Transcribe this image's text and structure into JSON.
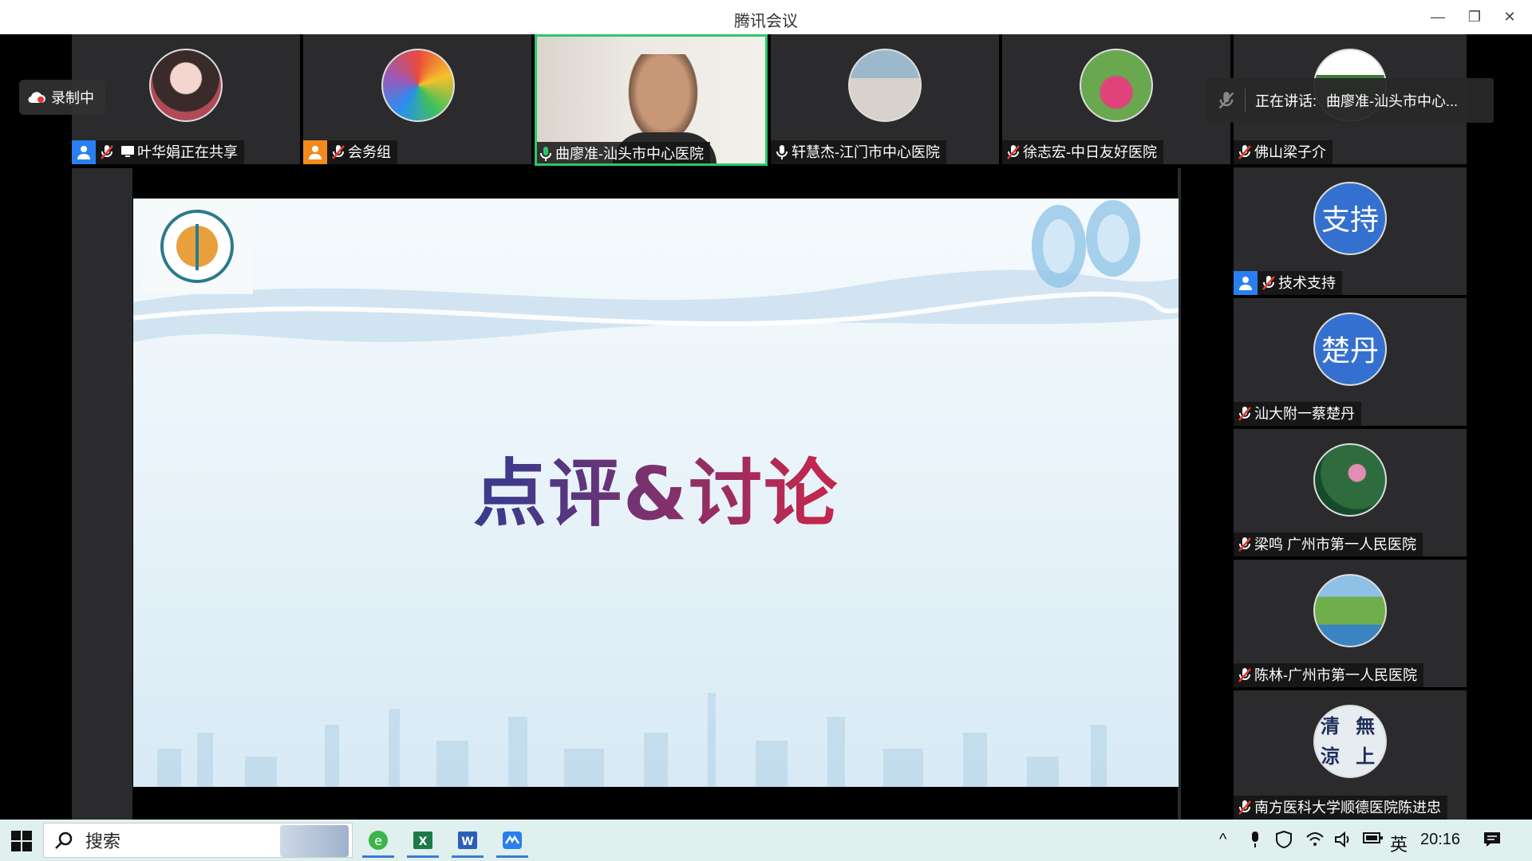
{
  "window": {
    "title": "腾讯会议"
  },
  "recording": {
    "label": "录制中"
  },
  "speaking": {
    "label": "正在讲话:",
    "name": "曲廖准-汕头市中心..."
  },
  "top_tiles": [
    {
      "name": "叶华娟正在共享"
    },
    {
      "name": "会务组"
    },
    {
      "name": "曲廖准-汕头市中心医院"
    },
    {
      "name": "轩慧杰-江门市中心医院"
    },
    {
      "name": "徐志宏-中日友好医院"
    },
    {
      "name": "佛山梁子介"
    }
  ],
  "side_tiles": [
    {
      "name": "技术支持",
      "initials": "支持"
    },
    {
      "name": "汕大附一蔡楚丹",
      "initials": "楚丹"
    },
    {
      "name": "梁鸣 广州市第一人民医院"
    },
    {
      "name": "陈林-广州市第一人民医院"
    },
    {
      "name": "南方医科大学顺德医院陈进忠",
      "avatar_text": "清 無 涼 上"
    }
  ],
  "slide": {
    "title": "点评&讨论"
  },
  "taskbar": {
    "search_label": "搜索",
    "ime": "英",
    "time": "20:16"
  },
  "colors": {
    "active_speaker_border": "#2ec76a",
    "role_blue": "#2a7ff0",
    "role_orange": "#f28a1e",
    "slide_title_left": "#3b3a8c",
    "slide_title_right": "#c0284f"
  }
}
